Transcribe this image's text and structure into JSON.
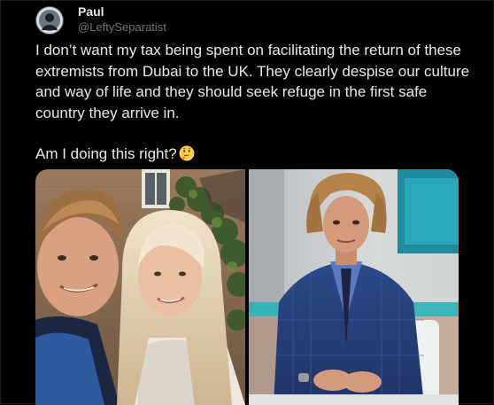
{
  "tweet": {
    "author": {
      "display_name": "Paul",
      "handle": "@LeftySeparatist",
      "avatar_icon": "user-avatar"
    },
    "text_paragraphs": [
      "I don’t want my tax being spent on facilitating the return of these extremists from Dubai to the UK. They clearly despise our culture and way of life and they should seek refuge in the first safe country they arrive in.",
      "Am I doing this right?"
    ],
    "emoji": "thinking-face-emoji",
    "media": [
      {
        "kind": "photo",
        "icon": "photo-couple-selfie"
      },
      {
        "kind": "photo",
        "icon": "photo-tv-studio-man"
      }
    ]
  },
  "colors": {
    "background": "#000000",
    "text_primary": "#e7e9ea",
    "text_secondary": "#71767b"
  }
}
